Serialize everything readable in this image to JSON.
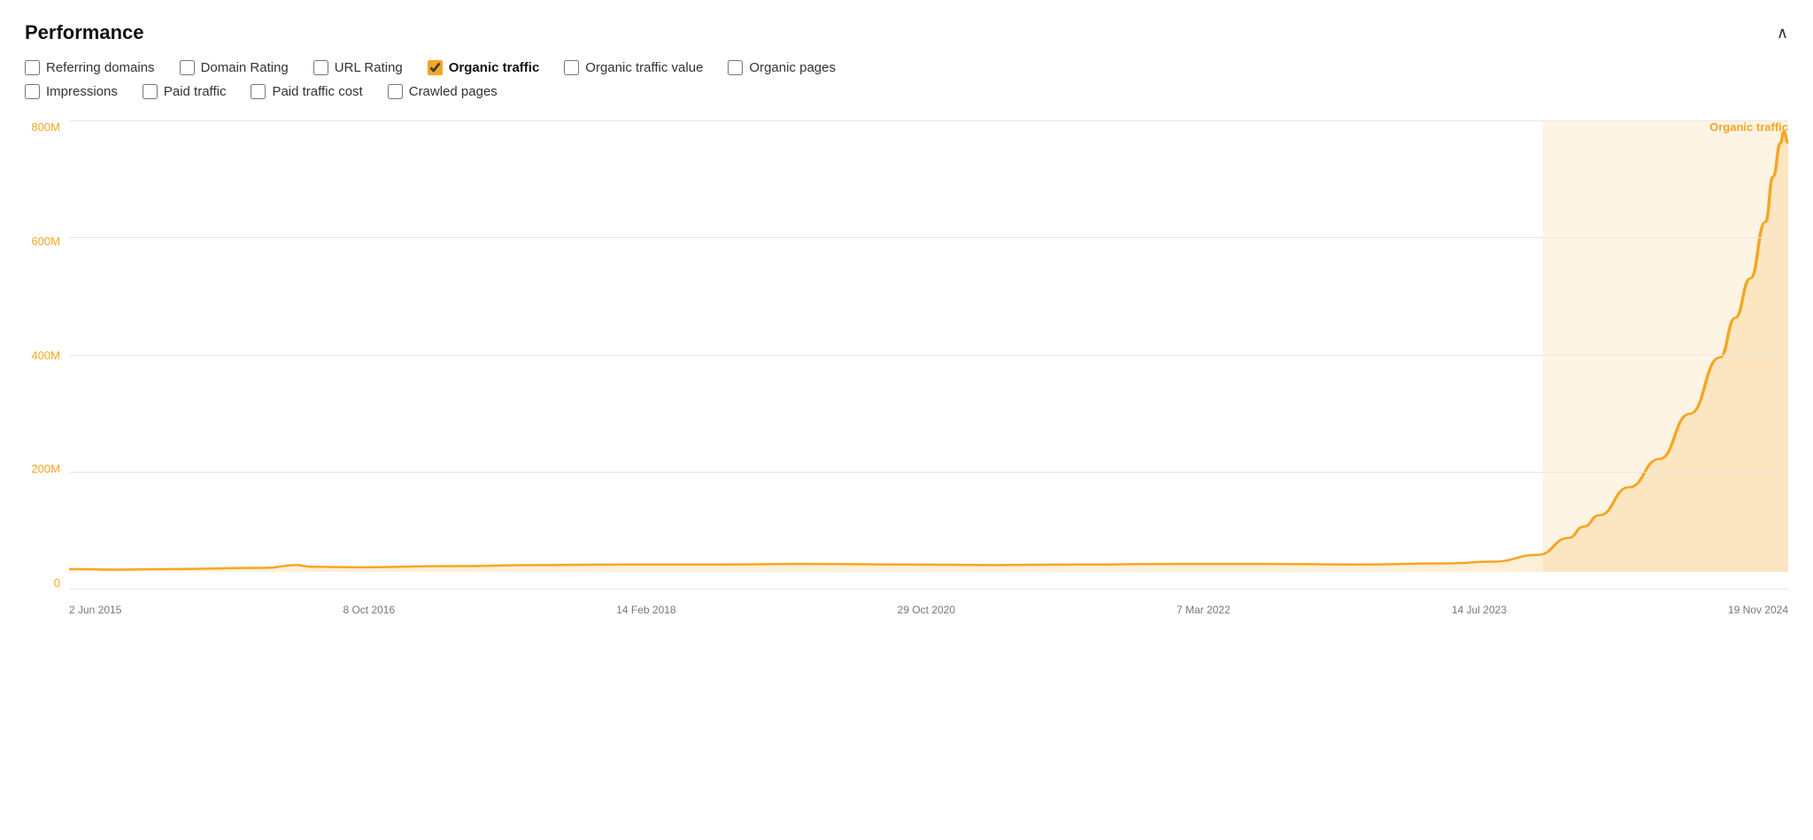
{
  "header": {
    "title": "Performance",
    "collapse_icon": "∧"
  },
  "checkboxes_row1": [
    {
      "id": "referring-domains",
      "label": "Referring domains",
      "checked": false
    },
    {
      "id": "domain-rating",
      "label": "Domain Rating",
      "checked": false
    },
    {
      "id": "url-rating",
      "label": "URL Rating",
      "checked": false
    },
    {
      "id": "organic-traffic",
      "label": "Organic traffic",
      "checked": true
    },
    {
      "id": "organic-traffic-value",
      "label": "Organic traffic value",
      "checked": false
    },
    {
      "id": "organic-pages",
      "label": "Organic pages",
      "checked": false
    }
  ],
  "checkboxes_row2": [
    {
      "id": "impressions",
      "label": "Impressions",
      "checked": false
    },
    {
      "id": "paid-traffic",
      "label": "Paid traffic",
      "checked": false
    },
    {
      "id": "paid-traffic-cost",
      "label": "Paid traffic cost",
      "checked": false
    },
    {
      "id": "crawled-pages",
      "label": "Crawled pages",
      "checked": false
    }
  ],
  "chart": {
    "legend_label": "Organic traffic",
    "y_labels": [
      "800M",
      "600M",
      "400M",
      "200M",
      "0"
    ],
    "x_labels": [
      "2 Jun 2015",
      "8 Oct 2016",
      "14 Feb 2018",
      "29 Oct 2020",
      "7 Mar 2022",
      "14 Jul 2023",
      "19 Nov 2024"
    ],
    "line_color": "#f5a623",
    "fill_color": "rgba(245,166,35,0.15)"
  }
}
